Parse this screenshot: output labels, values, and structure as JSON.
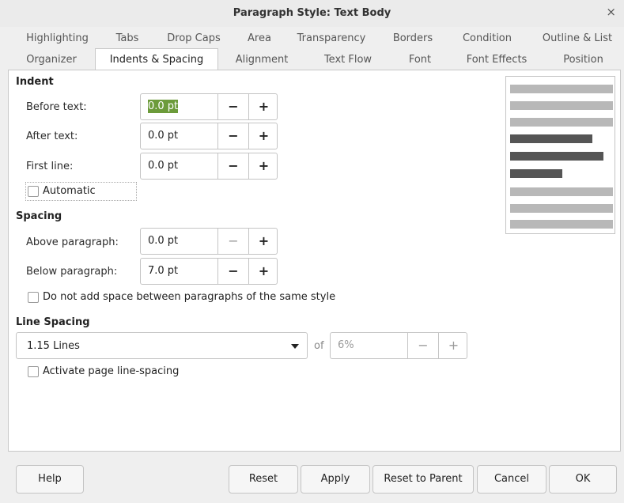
{
  "window": {
    "title": "Paragraph Style: Text Body",
    "close_glyph": "×"
  },
  "tabs_row1": [
    "Highlighting",
    "Tabs",
    "Drop Caps",
    "Area",
    "Transparency",
    "Borders",
    "Condition",
    "Outline & List"
  ],
  "tabs_row2": [
    "Organizer",
    "Indents & Spacing",
    "Alignment",
    "Text Flow",
    "Font",
    "Font Effects",
    "Position"
  ],
  "active_tab": "Indents & Spacing",
  "indent": {
    "title": "Indent",
    "before_text": {
      "label": "Before text:",
      "value": "0.0 pt"
    },
    "after_text": {
      "label": "After text:",
      "value": "0.0 pt"
    },
    "first_line": {
      "label": "First line:",
      "value": "0.0 pt"
    },
    "automatic": {
      "label": "Automatic",
      "checked": false
    }
  },
  "spacing": {
    "title": "Spacing",
    "above": {
      "label": "Above paragraph:",
      "value": "0.0 pt"
    },
    "below": {
      "label": "Below paragraph:",
      "value": "7.0 pt"
    },
    "no_space": {
      "label": "Do not add space between paragraphs of the same style",
      "checked": false
    }
  },
  "line_spacing": {
    "title": "Line Spacing",
    "mode": "1.15 Lines",
    "of_label": "of",
    "of_value": "6%",
    "activate": {
      "label": "Activate page line-spacing",
      "checked": false
    }
  },
  "spin_minus": "−",
  "spin_plus": "+",
  "buttons": {
    "help": "Help",
    "reset": "Reset",
    "apply": "Apply",
    "reset_parent": "Reset to Parent",
    "cancel": "Cancel",
    "ok": "OK"
  },
  "colors": {
    "selection": "#6c9b3a",
    "preview_light": "#b8b8b8",
    "preview_dark": "#555555"
  }
}
